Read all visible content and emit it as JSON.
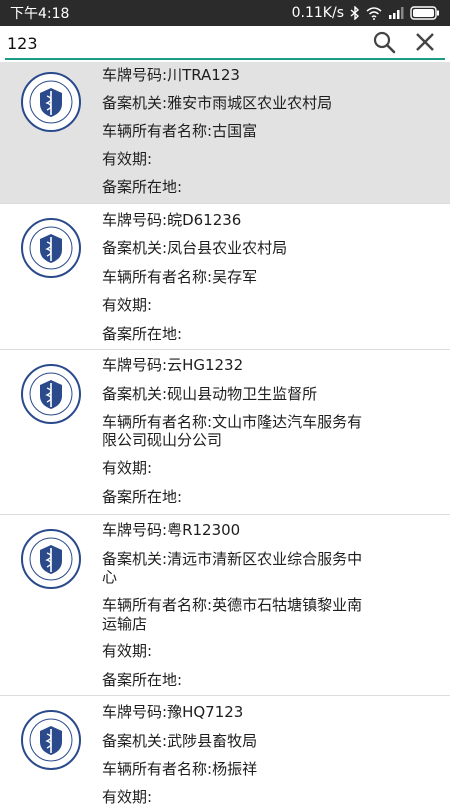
{
  "status_bar": {
    "time": "下午4:18",
    "network_speed": "0.11K/s"
  },
  "search": {
    "value": "123"
  },
  "labels": {
    "plate": "车牌号码:",
    "agency": "备案机关:",
    "owner": "车辆所有者名称:",
    "validity": "有效期:",
    "location": "备案所在地:"
  },
  "results": [
    {
      "plate": "川TRA123",
      "agency": "雅安市雨城区农业农村局",
      "owner": "古国富",
      "validity": "",
      "location": "",
      "selected": true
    },
    {
      "plate": "皖D61236",
      "agency": "凤台县农业农村局",
      "owner": "吴存军",
      "validity": "",
      "location": ""
    },
    {
      "plate": "云HG1232",
      "agency": "砚山县动物卫生监督所",
      "owner_line1": "文山市隆达汽车服务有",
      "owner_line2": "限公司砚山分公司",
      "validity": "",
      "location": ""
    },
    {
      "plate": "粤R12300",
      "agency_line1": "清远市清新区农业综合服务中",
      "agency_line2": "心",
      "owner_line1": "英德市石牯塘镇黎业南",
      "owner_line2": "运输店",
      "validity": "",
      "location": ""
    },
    {
      "plate": "豫HQ7123",
      "agency": "武陟县畜牧局",
      "owner": "杨振祥",
      "validity": ""
    }
  ],
  "colors": {
    "accent": "#1c9c86",
    "selected_row": "#e2e2e2",
    "status_bar": "#2b2b2b",
    "logo_blue": "#2a4a8c"
  },
  "icons": {
    "search": "search-icon",
    "clear": "close-icon",
    "logo": "animal-health-seal-icon"
  }
}
